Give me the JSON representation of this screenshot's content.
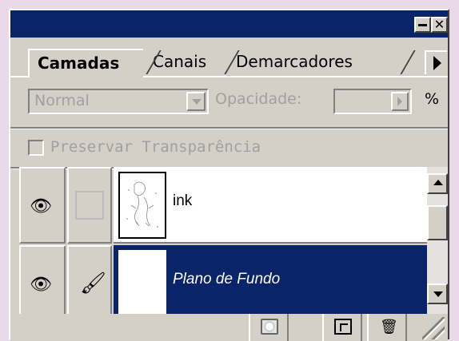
{
  "window": {
    "minimize_icon": "minimize-icon",
    "close_glyph": "✕"
  },
  "tabs": [
    {
      "label": "Camadas",
      "active": true
    },
    {
      "label": "Canais",
      "active": false
    },
    {
      "label": "Demarcadores",
      "active": false
    }
  ],
  "blend_mode": {
    "value": "Normal"
  },
  "opacity": {
    "label": "Opacidade:",
    "value": "",
    "unit": "%"
  },
  "preserve_transparency": {
    "label": "Preservar Transparência",
    "checked": false
  },
  "layers": [
    {
      "name": "ink",
      "visible": true,
      "selected": false,
      "brush": false
    },
    {
      "name": "Plano de Fundo",
      "visible": true,
      "selected": true,
      "brush": true
    }
  ],
  "icons": {
    "eye": "👁",
    "brush": "🖌",
    "trash": "🗑"
  },
  "colors": {
    "titlebar": "#0a246a",
    "selection": "#0a246a",
    "panel": "#d4d0c8"
  }
}
